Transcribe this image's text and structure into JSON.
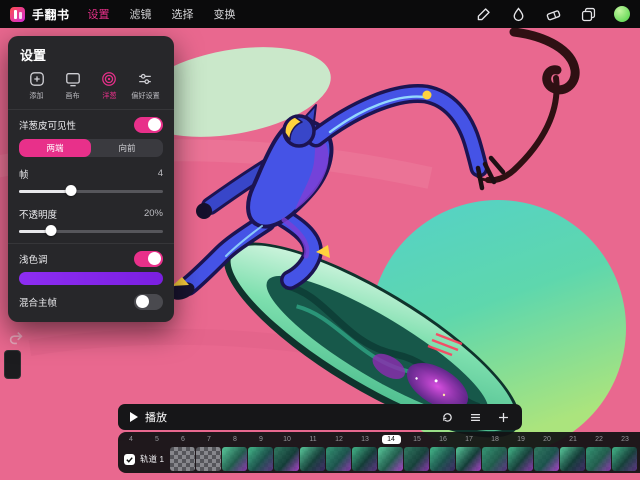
{
  "app": {
    "title": "手翻书",
    "menu": [
      "设置",
      "滤镜",
      "选择",
      "变换"
    ],
    "active_menu": "设置"
  },
  "colors": {
    "accent": "#e8308a",
    "canvas_pink": "#e9688f",
    "color_swatch": "#6edb5e",
    "tint_color": "#8d2df2",
    "tint_color_end": "#7a1fe0"
  },
  "toolbar": {
    "icons": [
      "brush-icon",
      "smudge-icon",
      "eraser-icon",
      "layers-icon",
      "color-swatch"
    ]
  },
  "settings_panel": {
    "title": "设置",
    "tabs": [
      {
        "label": "添加",
        "icon": "add"
      },
      {
        "label": "画布",
        "icon": "canvas"
      },
      {
        "label": "洋葱",
        "icon": "onion"
      },
      {
        "label": "偏好设置",
        "icon": "prefs"
      }
    ],
    "active_tab": "洋葱",
    "onion_visibility": {
      "label": "洋葱皮可见性",
      "on": true
    },
    "direction": {
      "options": [
        "两端",
        "向前"
      ],
      "selected": "两端"
    },
    "frames": {
      "label": "帧",
      "value": "4",
      "percent": 36
    },
    "opacity": {
      "label": "不透明度",
      "value": "20%",
      "percent": 22
    },
    "tint": {
      "label": "浅色调",
      "on": true
    },
    "blend": {
      "label": "混合主帧",
      "on": false
    }
  },
  "left_controls": {
    "icons": [
      "undo-icon",
      "redo-icon",
      "side-panel-handle"
    ]
  },
  "timeline": {
    "play_label": "播放",
    "playbar_icons": [
      "loop-icon",
      "list-icon",
      "add-frame-icon"
    ],
    "frames": [
      "4",
      "5",
      "6",
      "7",
      "8",
      "9",
      "10",
      "11",
      "12",
      "13",
      "14",
      "15",
      "16",
      "17",
      "18",
      "19",
      "20",
      "21",
      "22",
      "23"
    ],
    "current_frame": "14",
    "track": {
      "label": "轨道 1",
      "checked": true
    },
    "thumbs": [
      {
        "t": "checker"
      },
      {
        "t": "checker"
      },
      {
        "t": "art",
        "g": [
          "#57d3a0",
          "#1d5c4b",
          "#8e2fb4"
        ]
      },
      {
        "t": "art",
        "g": [
          "#3fbf8c",
          "#17514a",
          "#5a2c86"
        ]
      },
      {
        "t": "art",
        "g": [
          "#2a7a5f",
          "#0f3b35",
          "#b13bd4"
        ]
      },
      {
        "t": "art",
        "g": [
          "#57d3a0",
          "#123f38",
          "#3a1f66"
        ]
      },
      {
        "t": "art",
        "g": [
          "#2f9a74",
          "#17514a",
          "#8e2fb4"
        ]
      },
      {
        "t": "art",
        "g": [
          "#3fbf8c",
          "#0f3b35",
          "#5a2c86"
        ]
      },
      {
        "t": "art",
        "g": [
          "#57d3a0",
          "#1d5c4b",
          "#b13bd4"
        ]
      },
      {
        "t": "art",
        "g": [
          "#2a7a5f",
          "#123f38",
          "#8e2fb4"
        ]
      },
      {
        "t": "art",
        "g": [
          "#3fbf8c",
          "#17514a",
          "#3a1f66"
        ]
      },
      {
        "t": "art",
        "g": [
          "#57d3a0",
          "#0f3b35",
          "#b13bd4"
        ]
      },
      {
        "t": "art",
        "g": [
          "#2f9a74",
          "#1d5c4b",
          "#5a2c86"
        ]
      },
      {
        "t": "art",
        "g": [
          "#3fbf8c",
          "#123f38",
          "#8e2fb4"
        ]
      },
      {
        "t": "art",
        "g": [
          "#2a7a5f",
          "#17514a",
          "#b13bd4"
        ]
      },
      {
        "t": "art",
        "g": [
          "#57d3a0",
          "#0f3b35",
          "#3a1f66"
        ]
      },
      {
        "t": "art",
        "g": [
          "#2f9a74",
          "#1d5c4b",
          "#8e2fb4"
        ]
      },
      {
        "t": "art",
        "g": [
          "#3fbf8c",
          "#123f38",
          "#5a2c86"
        ]
      }
    ]
  }
}
